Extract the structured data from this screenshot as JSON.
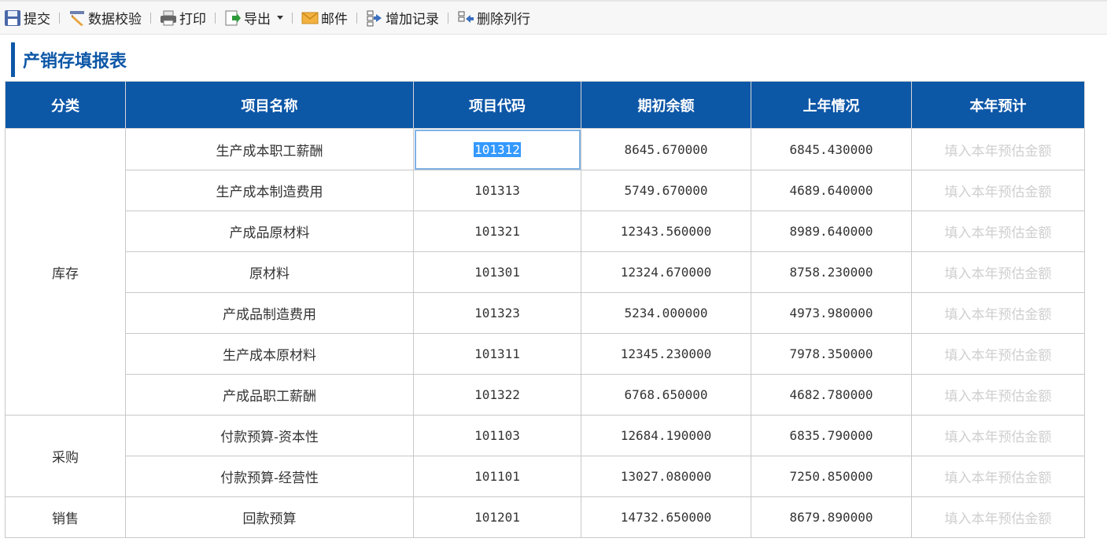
{
  "toolbar": {
    "submit": "提交",
    "validate": "数据校验",
    "print": "打印",
    "export": "导出",
    "mail": "邮件",
    "add_record": "增加记录",
    "delete_row": "删除列行"
  },
  "page_title": "产销存填报表",
  "columns": [
    "分类",
    "项目名称",
    "项目代码",
    "期初余额",
    "上年情况",
    "本年预计"
  ],
  "categories": {
    "inventory": "库存",
    "purchase": "采购",
    "sales": "销售"
  },
  "rows": [
    {
      "name": "生产成本职工薪酬",
      "code": "101312",
      "opening": "8645.670000",
      "last_year": "6845.430000",
      "estimate": "填入本年预估金额"
    },
    {
      "name": "生产成本制造费用",
      "code": "101313",
      "opening": "5749.670000",
      "last_year": "4689.640000",
      "estimate": "填入本年预估金额"
    },
    {
      "name": "产成品原材料",
      "code": "101321",
      "opening": "12343.560000",
      "last_year": "8989.640000",
      "estimate": "填入本年预估金额"
    },
    {
      "name": "原材料",
      "code": "101301",
      "opening": "12324.670000",
      "last_year": "8758.230000",
      "estimate": "填入本年预估金额"
    },
    {
      "name": "产成品制造费用",
      "code": "101323",
      "opening": "5234.000000",
      "last_year": "4973.980000",
      "estimate": "填入本年预估金额"
    },
    {
      "name": "生产成本原材料",
      "code": "101311",
      "opening": "12345.230000",
      "last_year": "7978.350000",
      "estimate": "填入本年预估金额"
    },
    {
      "name": "产成品职工薪酬",
      "code": "101322",
      "opening": "6768.650000",
      "last_year": "4682.780000",
      "estimate": "填入本年预估金额"
    },
    {
      "name": "付款预算-资本性",
      "code": "101103",
      "opening": "12684.190000",
      "last_year": "6835.790000",
      "estimate": "填入本年预估金额"
    },
    {
      "name": "付款预算-经营性",
      "code": "101101",
      "opening": "13027.080000",
      "last_year": "7250.850000",
      "estimate": "填入本年预估金额"
    },
    {
      "name": "回款预算",
      "code": "101201",
      "opening": "14732.650000",
      "last_year": "8679.890000",
      "estimate": "填入本年预估金额"
    }
  ],
  "colors": {
    "header_bg": "#0d57a7",
    "title": "#0d57a7",
    "placeholder": "#cfcfcf"
  }
}
